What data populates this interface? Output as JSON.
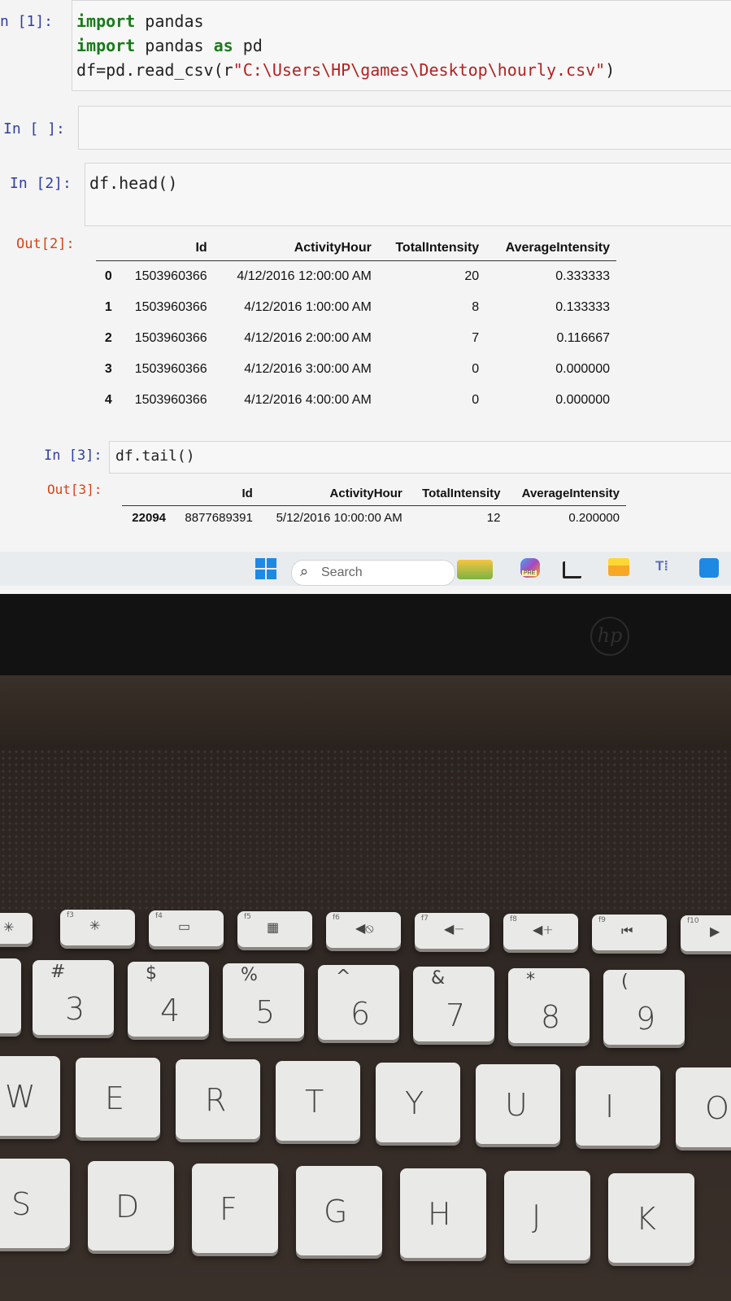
{
  "notebook": {
    "cell1": {
      "prompt": "n [1]:",
      "lines": [
        {
          "parts": [
            {
              "t": "import",
              "c": "kw"
            },
            {
              "t": " pandas",
              "c": ""
            }
          ]
        },
        {
          "parts": [
            {
              "t": "import",
              "c": "kw"
            },
            {
              "t": " pandas ",
              "c": ""
            },
            {
              "t": "as",
              "c": "kw"
            },
            {
              "t": " pd",
              "c": ""
            }
          ]
        },
        {
          "parts": [
            {
              "t": "df=pd.read_csv(r",
              "c": ""
            },
            {
              "t": "\"C:\\Users\\HP\\games\\Desktop\\hourly.csv\"",
              "c": "str"
            },
            {
              "t": ")",
              "c": ""
            }
          ]
        }
      ]
    },
    "cell_empty": {
      "prompt": "In [ ]:"
    },
    "cell2": {
      "prompt": "In [2]:",
      "code": "df.head()",
      "out_prompt": "Out[2]:",
      "columns": [
        "",
        "Id",
        "ActivityHour",
        "TotalIntensity",
        "AverageIntensity"
      ],
      "rows": [
        [
          "0",
          "1503960366",
          "4/12/2016 12:00:00 AM",
          "20",
          "0.333333"
        ],
        [
          "1",
          "1503960366",
          "4/12/2016 1:00:00 AM",
          "8",
          "0.133333"
        ],
        [
          "2",
          "1503960366",
          "4/12/2016 2:00:00 AM",
          "7",
          "0.116667"
        ],
        [
          "3",
          "1503960366",
          "4/12/2016 3:00:00 AM",
          "0",
          "0.000000"
        ],
        [
          "4",
          "1503960366",
          "4/12/2016 4:00:00 AM",
          "0",
          "0.000000"
        ]
      ]
    },
    "cell3": {
      "prompt": "In [3]:",
      "code": "df.tail()",
      "out_prompt": "Out[3]:",
      "columns": [
        "",
        "Id",
        "ActivityHour",
        "TotalIntensity",
        "AverageIntensity"
      ],
      "rows": [
        [
          "22094",
          "8877689391",
          "5/12/2016 10:00:00 AM",
          "12",
          "0.200000"
        ]
      ]
    }
  },
  "taskbar": {
    "search_label": "Search",
    "icons": [
      "windows-start-icon",
      "search-icon",
      "widgets-icon",
      "copilot-icon",
      "task-view-icon",
      "file-explorer-icon",
      "teams-icon",
      "store-icon"
    ],
    "copilot_badge": "PRE"
  },
  "colors": {
    "accent": "#303f9f",
    "out_prompt": "#d84315",
    "keyword": "#1a7a1a",
    "string": "#b22222"
  },
  "keyboard": {
    "brand": "hp",
    "fkeys": [
      {
        "fn": "f3",
        "glyph": "✳"
      },
      {
        "fn": "f4",
        "glyph": "▭"
      },
      {
        "fn": "f5",
        "glyph": "▦"
      },
      {
        "fn": "f6",
        "glyph": "◀⦸"
      },
      {
        "fn": "f7",
        "glyph": "◀−"
      },
      {
        "fn": "f8",
        "glyph": "◀+"
      },
      {
        "fn": "f9",
        "glyph": "⏮"
      },
      {
        "fn": "f10",
        "glyph": "▶"
      }
    ],
    "numrow": [
      {
        "sym": "#",
        "num": "3"
      },
      {
        "sym": "$",
        "num": "4"
      },
      {
        "sym": "%",
        "num": "5"
      },
      {
        "sym": "^",
        "num": "6"
      },
      {
        "sym": "&",
        "num": "7"
      },
      {
        "sym": "*",
        "num": "8"
      },
      {
        "sym": "(",
        "num": "9"
      }
    ],
    "row_qwerty": [
      "W",
      "E",
      "R",
      "T",
      "Y",
      "U",
      "I",
      "O"
    ],
    "row_asdf": [
      "S",
      "D",
      "F",
      "G",
      "H",
      "J",
      "K"
    ]
  }
}
